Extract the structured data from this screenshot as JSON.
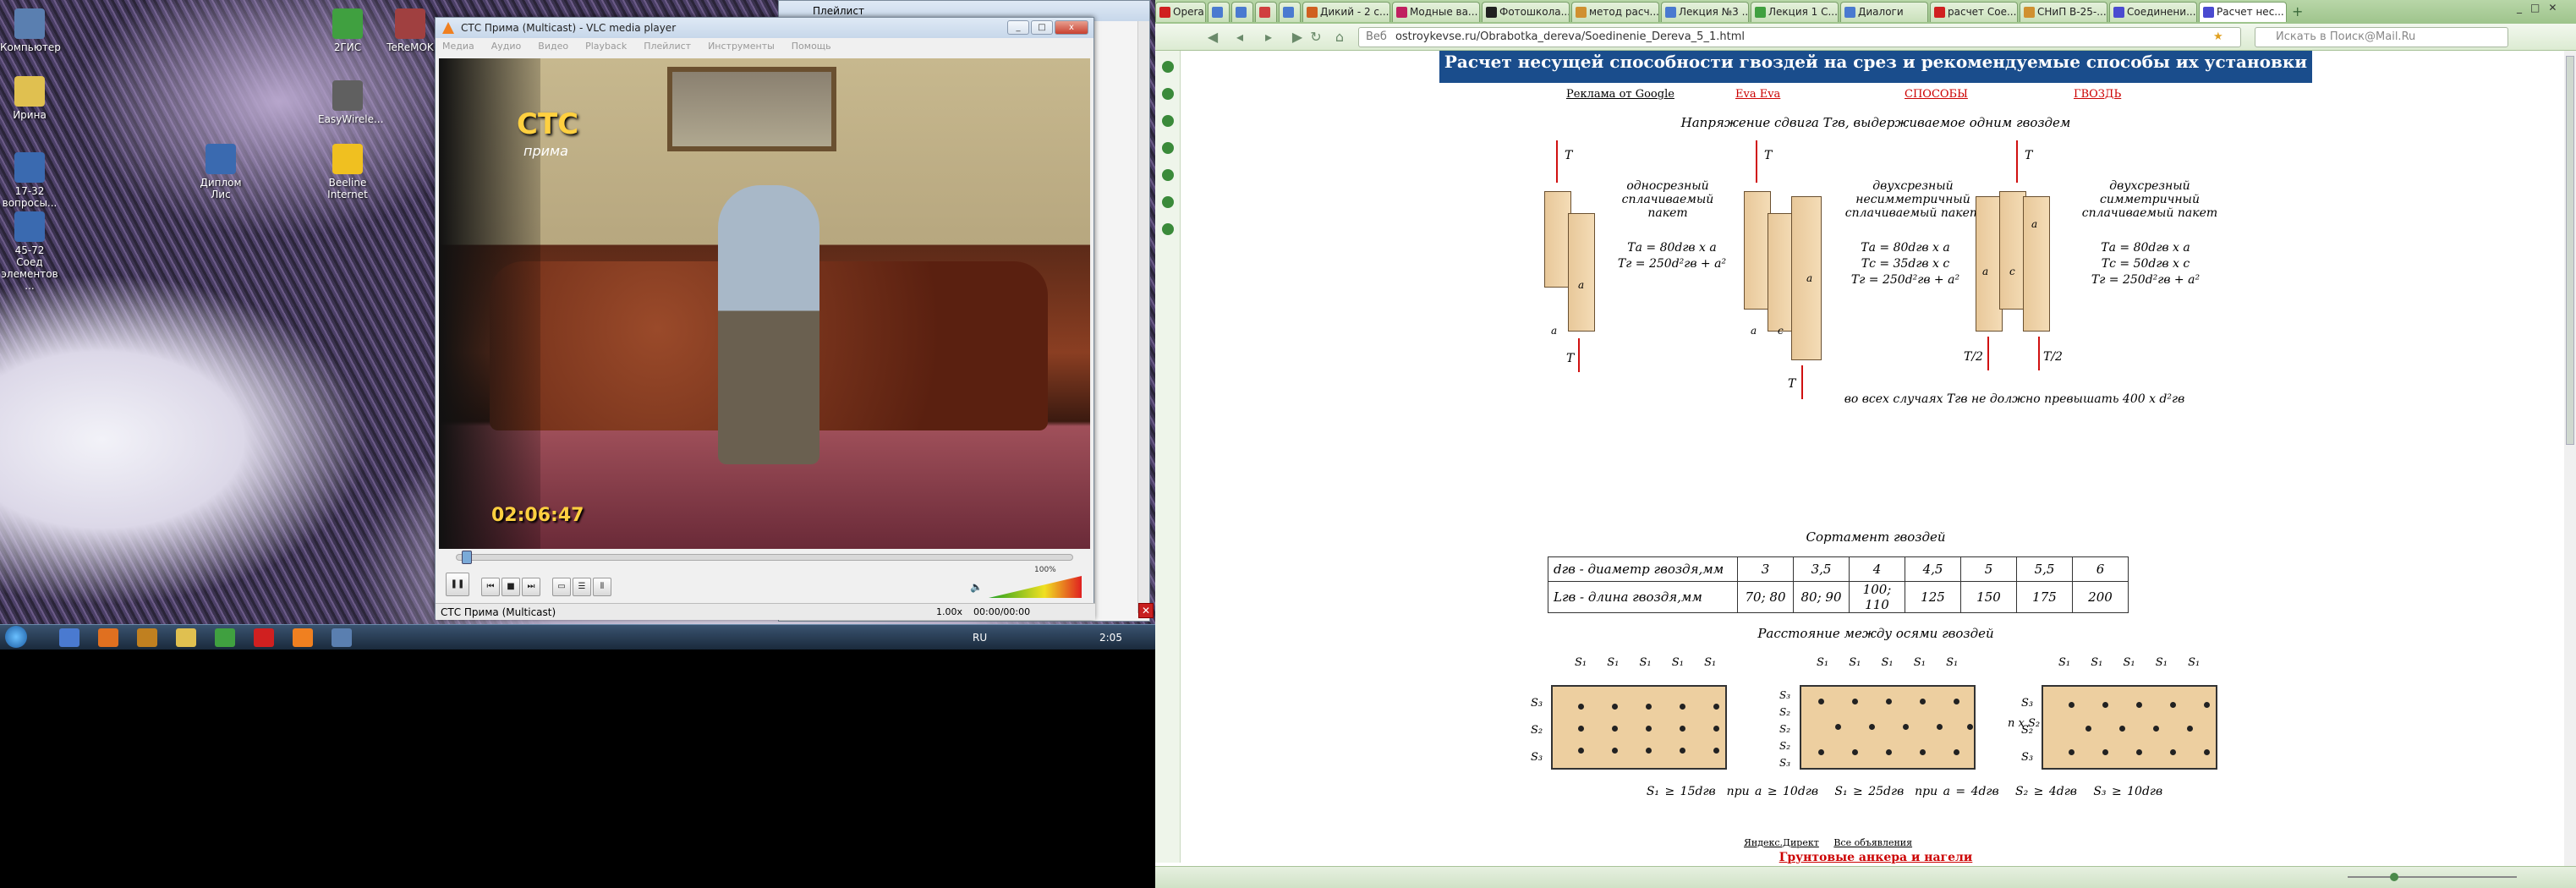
{
  "desktop": {
    "icons": [
      {
        "label": "Компьютер",
        "color": "#5a7fb0"
      },
      {
        "label": "Ирина",
        "color": "#e0c050"
      },
      {
        "label": "17-32 вопросы...",
        "color": "#3a6ab0"
      },
      {
        "label": "45-72 Соед элементов ...",
        "color": "#3a6ab0"
      },
      {
        "label": "2ГИС",
        "color": "#40a040"
      },
      {
        "label": "TeReMOK",
        "color": "#a04040"
      },
      {
        "label": "EasyWirele...",
        "color": "#606060"
      },
      {
        "label": "Диплом Лис",
        "color": "#3a6ab0"
      },
      {
        "label": "Beeline Internet",
        "color": "#f0c020"
      }
    ],
    "taskbar": {
      "lang": "RU",
      "time": "2:05"
    }
  },
  "vlc": {
    "title": "СТС Прима (Multicast) - VLC media player",
    "menu": [
      "Медиа",
      "Аудио",
      "Видео",
      "Playback",
      "Плейлист",
      "Инструменты",
      "Помощь"
    ],
    "channel_logo": "СТС",
    "channel_sub": "прима",
    "video_clock": "02:06:47",
    "status_text": "СТС Прима (Multicast)",
    "speed": "1.00x",
    "time": "00:00/00:00",
    "volume_label": "100%",
    "volume_level": 1.0
  },
  "playlist": {
    "title": "Плейлист"
  },
  "browser": {
    "tabs": [
      {
        "label": "Opera",
        "color": "#d02020"
      },
      {
        "label": "",
        "color": "#4a7ad0"
      },
      {
        "label": "",
        "color": "#4a7ad0"
      },
      {
        "label": "",
        "color": "#d04040"
      },
      {
        "label": "",
        "color": "#4a7ad0"
      },
      {
        "label": "Дикий - 2 с...",
        "color": "#d06020"
      },
      {
        "label": "Модные ва...",
        "color": "#c02060"
      },
      {
        "label": "Фотошкола...",
        "color": "#202020"
      },
      {
        "label": "метод расч...",
        "color": "#d09030"
      },
      {
        "label": "Лекция №3 ...",
        "color": "#4a7ad0"
      },
      {
        "label": "Лекция 1 С...",
        "color": "#40a040"
      },
      {
        "label": "Диалоги",
        "color": "#4a7ad0"
      },
      {
        "label": "расчет Сое...",
        "color": "#d02020"
      },
      {
        "label": "СНиП В-25-...",
        "color": "#d09030"
      },
      {
        "label": "Соединени...",
        "color": "#4a4ad0"
      },
      {
        "label": "Расчет нес...",
        "color": "#4a4ad0"
      }
    ],
    "address_prefix": "Веб",
    "url": "ostroykevse.ru/Obrabotka_dereva/Soedinenie_Dereva_5_1.html",
    "search_placeholder": "Искать в Поиск@Mail.Ru"
  },
  "page": {
    "banner": "Расчет несущей способности гвоздей на срез и рекомендуемые способы их установки",
    "nav": [
      "Реклама от Google",
      "Eva Eva",
      "СПОСОБЫ",
      "ГВОЗДЬ"
    ],
    "shear_title": "Напряжение сдвига Tгв, выдерживаемое одним гвоздем",
    "diagrams": [
      {
        "title": "односрезный сплачиваемый пакет",
        "formulas": [
          "Tа = 80dгв x a",
          "Tг = 250d²гв + a²"
        ],
        "top": "T",
        "bottom": "T",
        "labels": [
          "a",
          "a"
        ]
      },
      {
        "title": "двухсрезный несимметричный сплачиваемый пакет",
        "formulas": [
          "Tа = 80dгв x a",
          "Tс = 35dгв x c",
          "Tг = 250d²гв + a²"
        ],
        "top": "T",
        "bottom": "T",
        "labels": [
          "a",
          "a",
          "c"
        ]
      },
      {
        "title": "двухсрезный симметричный сплачиваемый пакет",
        "formulas": [
          "Tа = 80dгв x a",
          "Tс = 50dгв x c",
          "Tг = 250d²гв + a²"
        ],
        "top": "T",
        "bottom_left": "T/2",
        "bottom_right": "T/2",
        "labels": [
          "a",
          "a",
          "c"
        ]
      }
    ],
    "shear_note": "во всех случаях Tгв не должно превышать 400 x d²гв",
    "sortment_title": "Сортамент гвоздей",
    "sortment": {
      "rows": [
        {
          "label": "dгв - диаметр гвоздя,мм",
          "values": [
            "3",
            "3,5",
            "4",
            "4,5",
            "5",
            "5,5",
            "6"
          ]
        },
        {
          "label": "Lгв - длина гвоздя,мм",
          "values": [
            "70; 80",
            "80; 90",
            "100; 110",
            "125",
            "150",
            "175",
            "200"
          ]
        }
      ]
    },
    "spacing_title": "Расстояние между осями гвоздей",
    "spacing_labels": {
      "s1": "S₁",
      "s2": "S₂",
      "s3": "S₃",
      "nxs2": "n x S₂"
    },
    "spacing_rules": [
      "S₁ ≥ 15dгв",
      "при a ≥ 10dгв",
      "S₁ ≥ 25dгв",
      "при a = 4dгв",
      "S₂ ≥ 4dгв",
      "S₃ ≥ 10dгв"
    ],
    "footer_links": [
      "Яндекс.Директ",
      "Все объявления"
    ],
    "footer_ad": "Грунтовые анкера и нагели"
  }
}
